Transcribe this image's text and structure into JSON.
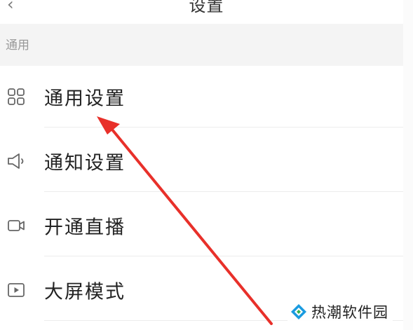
{
  "header": {
    "title": "设置",
    "back_icon": "chevron-left-icon"
  },
  "section": {
    "label": "通用"
  },
  "menu": [
    {
      "label": "通用设置",
      "icon": "grid-icon"
    },
    {
      "label": "通知设置",
      "icon": "speaker-icon"
    },
    {
      "label": "开通直播",
      "icon": "video-camera-icon"
    },
    {
      "label": "大屏模式",
      "icon": "play-screen-icon"
    }
  ],
  "annotation": {
    "arrow_color": "#e8302a"
  },
  "watermark": {
    "text": "热潮软件园",
    "logo_colors": [
      "#1a9be0",
      "#37b24d"
    ]
  }
}
